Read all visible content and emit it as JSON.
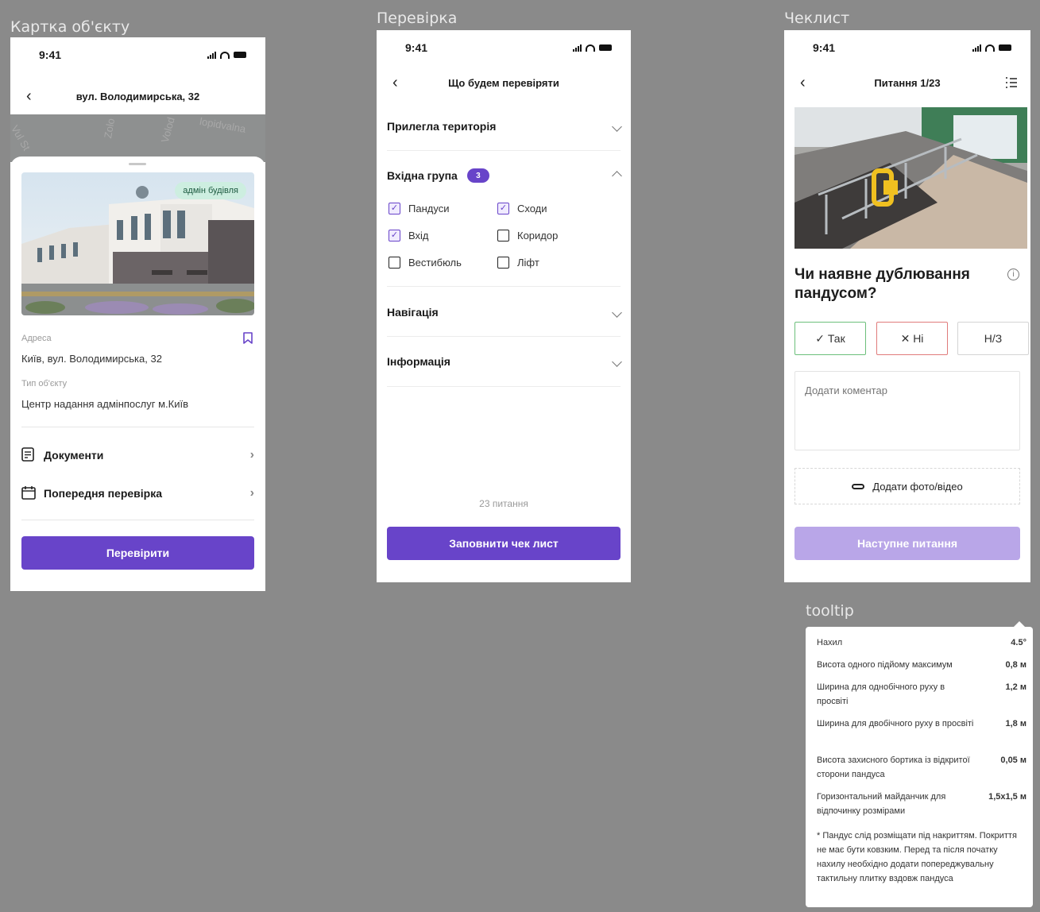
{
  "frames": {
    "object_card": "Картка об'єкту",
    "check": "Перевірка",
    "checklist": "Чеклист",
    "tooltip": "tooltip"
  },
  "status_time": "9:41",
  "screen1": {
    "nav_title": "вул. Володимирська, 32",
    "map_labels": [
      "Zolo",
      "Volod",
      "Vul St",
      "lopidvalna"
    ],
    "photo_tag": "адмін будівля",
    "address_label": "Адреса",
    "address_value": "Київ, вул. Володимирська, 32",
    "type_label": "Тип об'єкту",
    "type_value": "Центр надання адмінпослуг м.Київ",
    "documents": "Документи",
    "previous_check": "Попередня перевірка",
    "check_button": "Перевірити"
  },
  "screen2": {
    "nav_title": "Що будем перевіряти",
    "sections": {
      "adjacent": "Прилегла територія",
      "entrance": "Вхідна група",
      "entrance_count": "3",
      "navigation": "Навігація",
      "information": "Інформація"
    },
    "checkboxes": [
      {
        "label": "Пандуси",
        "checked": true
      },
      {
        "label": "Сходи",
        "checked": true
      },
      {
        "label": "Вхід",
        "checked": true
      },
      {
        "label": "Коридор",
        "checked": false
      },
      {
        "label": "Вестибюль",
        "checked": false
      },
      {
        "label": "Ліфт",
        "checked": false
      }
    ],
    "questions_count": "23 питання",
    "fill_button": "Заповнити чек лист"
  },
  "screen3": {
    "nav_title": "Питання 1/23",
    "question": "Чи наявне дублювання пандусом?",
    "answers": {
      "yes": "✓ Так",
      "no": "✕ Ні",
      "na": "Н/З"
    },
    "comment_placeholder": "Додати коментар",
    "attach": "Додати фото/відео",
    "next_button": "Наступне питання"
  },
  "tooltip": {
    "rows": [
      {
        "name": "Нахил",
        "value": "4.5°"
      },
      {
        "name": "Висота одного підйому максимум",
        "value": "0,8 м"
      },
      {
        "name": "Ширина для однобічного руху в просвіті",
        "value": "1,2 м"
      },
      {
        "name": "Ширина для двобічного руху в просвіті",
        "value": "1,8 м"
      },
      {
        "name": "Висота захисного бортика із відкритої сторони пандуса",
        "value": "0,05 м"
      },
      {
        "name": "Горизонтальний майданчик для відпочинку розмірами",
        "value": "1,5х1,5 м"
      }
    ],
    "note": "* Пандус слід розміщати під накриттям. Покриття не має бути ковзким. Перед та після початку нахилу необхідно додати попереджувальну тактильну плитку вздовж пандуса"
  },
  "colors": {
    "accent": "#6844c9",
    "accent_disabled": "#b9a6e8",
    "yes_border": "#6cbf7b",
    "no_border": "#e07b7b",
    "canvas": "#8a8a8a"
  },
  "icons": [
    "back-icon",
    "bookmark-icon",
    "document-icon",
    "calendar-icon",
    "chevron-right-icon",
    "chevron-down-icon",
    "chevron-up-icon",
    "list-icon",
    "info-icon",
    "paperclip-icon"
  ]
}
